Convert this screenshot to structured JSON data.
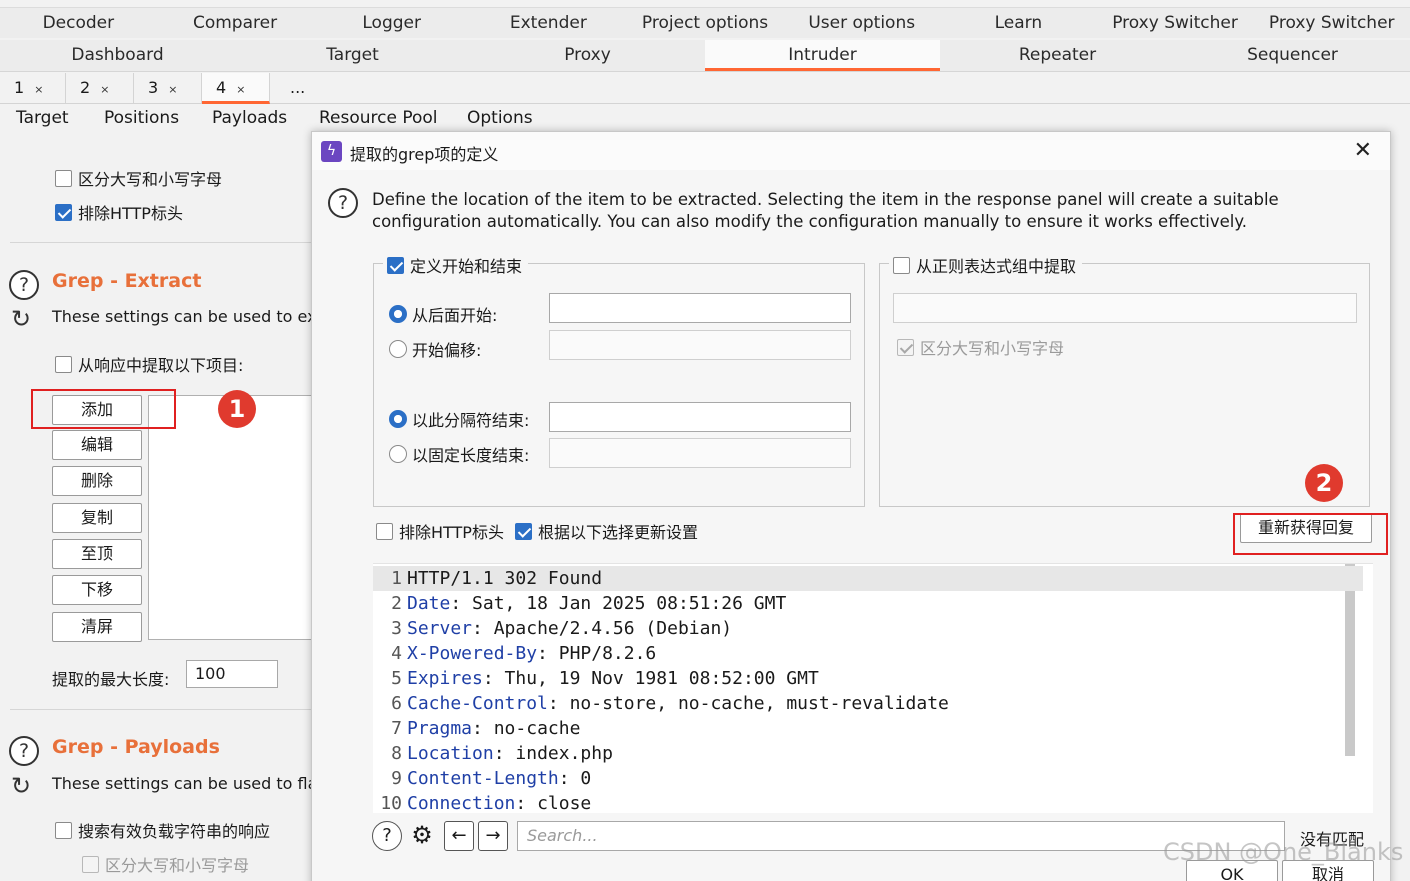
{
  "tool_tabs_row1": [
    "Decoder",
    "Comparer",
    "Logger",
    "Extender",
    "Project options",
    "User options",
    "Learn",
    "Proxy Switcher",
    "Proxy Switcher"
  ],
  "tool_tabs_row2": [
    "Dashboard",
    "Target",
    "Proxy",
    "Intruder",
    "Repeater",
    "Sequencer"
  ],
  "active_tool": "Intruder",
  "intruder_tabs": [
    {
      "label": "1",
      "close": "×"
    },
    {
      "label": "2",
      "close": "×"
    },
    {
      "label": "3",
      "close": "×"
    },
    {
      "label": "4",
      "close": "×"
    },
    {
      "label": "...",
      "close": ""
    }
  ],
  "attack_tabs": [
    "Target",
    "Positions",
    "Payloads",
    "Resource Pool",
    "Options"
  ],
  "left": {
    "case_sensitive": "区分大写和小写字母",
    "exclude_http_headers": "排除HTTP标头",
    "grep_extract_title": "Grep - Extract",
    "grep_extract_desc": "These settings can be used to extr",
    "extract_items": "从响应中提取以下项目:",
    "buttons": {
      "add": "添加",
      "edit": "编辑",
      "delete": "删除",
      "copy": "复制",
      "top": "至顶",
      "down": "下移",
      "clear": "清屏"
    },
    "max_length_label": "提取的最大长度:",
    "max_length_value": "100",
    "grep_payloads_title": "Grep - Payloads",
    "grep_payloads_desc": "These settings can be used to flag",
    "search_payload": "搜索有效负载字符串的响应",
    "case_sensitive_2": "区分大写和小写字母"
  },
  "markers": [
    "1",
    "2"
  ],
  "dialog": {
    "title": "提取的grep项的定义",
    "info": "Define the location of the item to be extracted. Selecting the item in the response panel will create a suitable configuration automatically. You can also modify the configuration manually to ensure it works effectively.",
    "define_start_end": "定义开始和结束",
    "start_after": "从后面开始:",
    "start_offset": "开始偏移:",
    "end_at_delimiter": "以此分隔符结束:",
    "end_fixed_length": "以固定长度结束:",
    "extract_regex": "从正则表达式组中提取",
    "regex_case_sensitive": "区分大写和小写字母",
    "exclude_http_headers": "排除HTTP标头",
    "update_config": "根据以下选择更新设置",
    "refetch_button": "重新获得回复",
    "response_lines": [
      {
        "n": "1",
        "key": "",
        "sep": "",
        "value": "HTTP/1.1 302 Found"
      },
      {
        "n": "2",
        "key": "Date",
        "sep": ": ",
        "value": "Sat, 18 Jan 2025 08:51:26 GMT"
      },
      {
        "n": "3",
        "key": "Server",
        "sep": ": ",
        "value": "Apache/2.4.56 (Debian)"
      },
      {
        "n": "4",
        "key": "X-Powered-By",
        "sep": ": ",
        "value": "PHP/8.2.6"
      },
      {
        "n": "5",
        "key": "Expires",
        "sep": ": ",
        "value": "Thu, 19 Nov 1981 08:52:00 GMT"
      },
      {
        "n": "6",
        "key": "Cache-Control",
        "sep": ": ",
        "value": "no-store, no-cache, must-revalidate"
      },
      {
        "n": "7",
        "key": "Pragma",
        "sep": ": ",
        "value": "no-cache"
      },
      {
        "n": "8",
        "key": "Location",
        "sep": ": ",
        "value": "index.php"
      },
      {
        "n": "9",
        "key": "Content-Length",
        "sep": ": ",
        "value": "0"
      },
      {
        "n": "10",
        "key": "Connection",
        "sep": ": ",
        "value": "close"
      }
    ],
    "search_placeholder": "Search...",
    "no_match": "没有匹配",
    "ok": "OK",
    "cancel": "取消"
  },
  "watermark": "CSDN @One_Blanks",
  "colors": {
    "accent": "#ff6633",
    "section_title": "#e8703a",
    "checkbox": "#2b6fc6",
    "header_key": "#1f3fa6",
    "marker": "#e03a2e"
  }
}
